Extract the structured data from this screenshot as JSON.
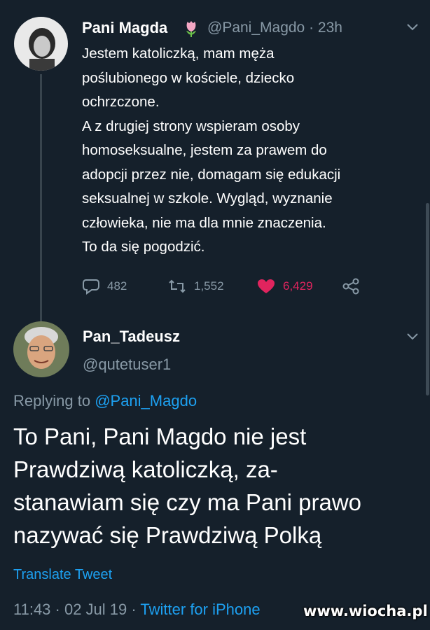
{
  "tweet1": {
    "author_name": "Pani Magda",
    "emoji": "tulip",
    "handle_time": "@Pani_Magdo · 23h",
    "text": "Jestem katoliczką, mam męża\npoślubionego w kościele,  dziecko\nochrzczone.\nA z drugiej strony wspieram osoby\nhomoseksualne, jestem za prawem do\nadopcji przez nie, domagam się edukacji\nseksualnej w szkole. Wygląd, wyznanie\nczłowieka, nie ma dla mnie znaczenia.\nTo da się pogodzić.",
    "replies": "482",
    "retweets": "1,552",
    "likes": "6,429",
    "like_color": "#e0245e"
  },
  "tweet2": {
    "author_name": "Pan_Tadeusz",
    "handle": "@qutetuser1",
    "replying_prefix": "Replying to ",
    "replying_to": "@Pani_Magdo",
    "text": "To Pani, Pani Magdo nie jest\nPrawdziwą katoliczką, za-\nstanawiam się czy ma Pani prawo\nnazywać się Prawdziwą Polką",
    "translate": "Translate Tweet",
    "timestamp": "11:43 · 02 Jul 19 · ",
    "source": "Twitter for iPhone"
  },
  "watermark": "www.wiocha.pl",
  "colors": {
    "background": "#15202b",
    "accent": "#1da1f2",
    "secondary": "#8899a6"
  },
  "icons": [
    "chevron-down-icon",
    "reply-icon",
    "retweet-icon",
    "heart-icon",
    "share-icon",
    "tulip-emoji-icon"
  ]
}
